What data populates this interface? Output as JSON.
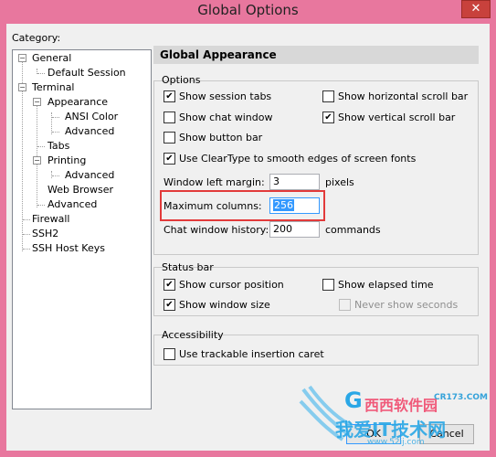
{
  "window": {
    "title": "Global Options",
    "close_glyph": "✕"
  },
  "category": {
    "label": "Category:",
    "tree": [
      {
        "label": "General",
        "expander": "−"
      },
      {
        "label": "Default Session"
      },
      {
        "label": "Terminal",
        "expander": "−"
      },
      {
        "label": "Appearance",
        "expander": "−"
      },
      {
        "label": "ANSI Color"
      },
      {
        "label": "Advanced"
      },
      {
        "label": "Tabs"
      },
      {
        "label": "Printing",
        "expander": "−"
      },
      {
        "label": "Advanced"
      },
      {
        "label": "Web Browser"
      },
      {
        "label": "Advanced"
      },
      {
        "label": "Firewall"
      },
      {
        "label": "SSH2"
      },
      {
        "label": "SSH Host Keys"
      }
    ]
  },
  "panel": {
    "header": "Global Appearance",
    "options": {
      "title": "Options",
      "show_session_tabs": {
        "label": "Show session tabs",
        "checked": true
      },
      "show_horizontal_scroll_bar": {
        "label": "Show horizontal scroll bar",
        "checked": false
      },
      "show_chat_window": {
        "label": "Show chat window",
        "checked": false
      },
      "show_vertical_scroll_bar": {
        "label": "Show vertical scroll bar",
        "checked": true
      },
      "show_button_bar": {
        "label": "Show button bar",
        "checked": false
      },
      "use_cleartype": {
        "label": "Use ClearType to smooth edges of screen fonts",
        "checked": true
      },
      "window_left_margin": {
        "label": "Window left margin:",
        "value": "3",
        "unit": "pixels"
      },
      "maximum_columns": {
        "label": "Maximum columns:",
        "value": "256"
      },
      "chat_window_history": {
        "label": "Chat window history:",
        "value": "200",
        "unit": "commands"
      }
    },
    "status_bar": {
      "title": "Status bar",
      "show_cursor_position": {
        "label": "Show cursor position",
        "checked": true
      },
      "show_elapsed_time": {
        "label": "Show elapsed time",
        "checked": false
      },
      "show_window_size": {
        "label": "Show window size",
        "checked": true
      },
      "never_show_seconds": {
        "label": "Never show seconds",
        "checked": false
      }
    },
    "accessibility": {
      "title": "Accessibility",
      "use_trackable_caret": {
        "label": "Use trackable insertion caret",
        "checked": false
      }
    }
  },
  "buttons": {
    "ok": "OK",
    "cancel": "Cancel"
  },
  "watermark": {
    "brand": "西西软件园",
    "domain": "CR173.COM",
    "slogan": "我爱IT技术网",
    "url": "www.52ij.com"
  },
  "check_glyph": "✔"
}
